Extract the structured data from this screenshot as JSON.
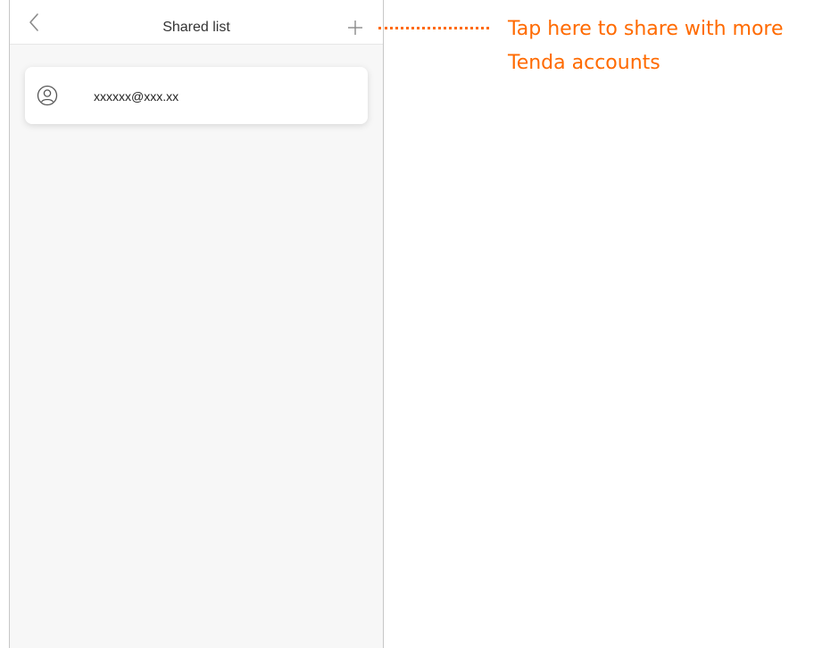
{
  "header": {
    "title": "Shared list",
    "back_icon": "chevron-left-icon",
    "add_icon": "plus-icon"
  },
  "shared_list": {
    "items": [
      {
        "icon": "user-circle-icon",
        "email": "xxxxxx@xxx.xx"
      }
    ]
  },
  "annotation": {
    "line1": "Tap here to share with more",
    "line2": "Tenda accounts",
    "color": "#ff6a00"
  }
}
